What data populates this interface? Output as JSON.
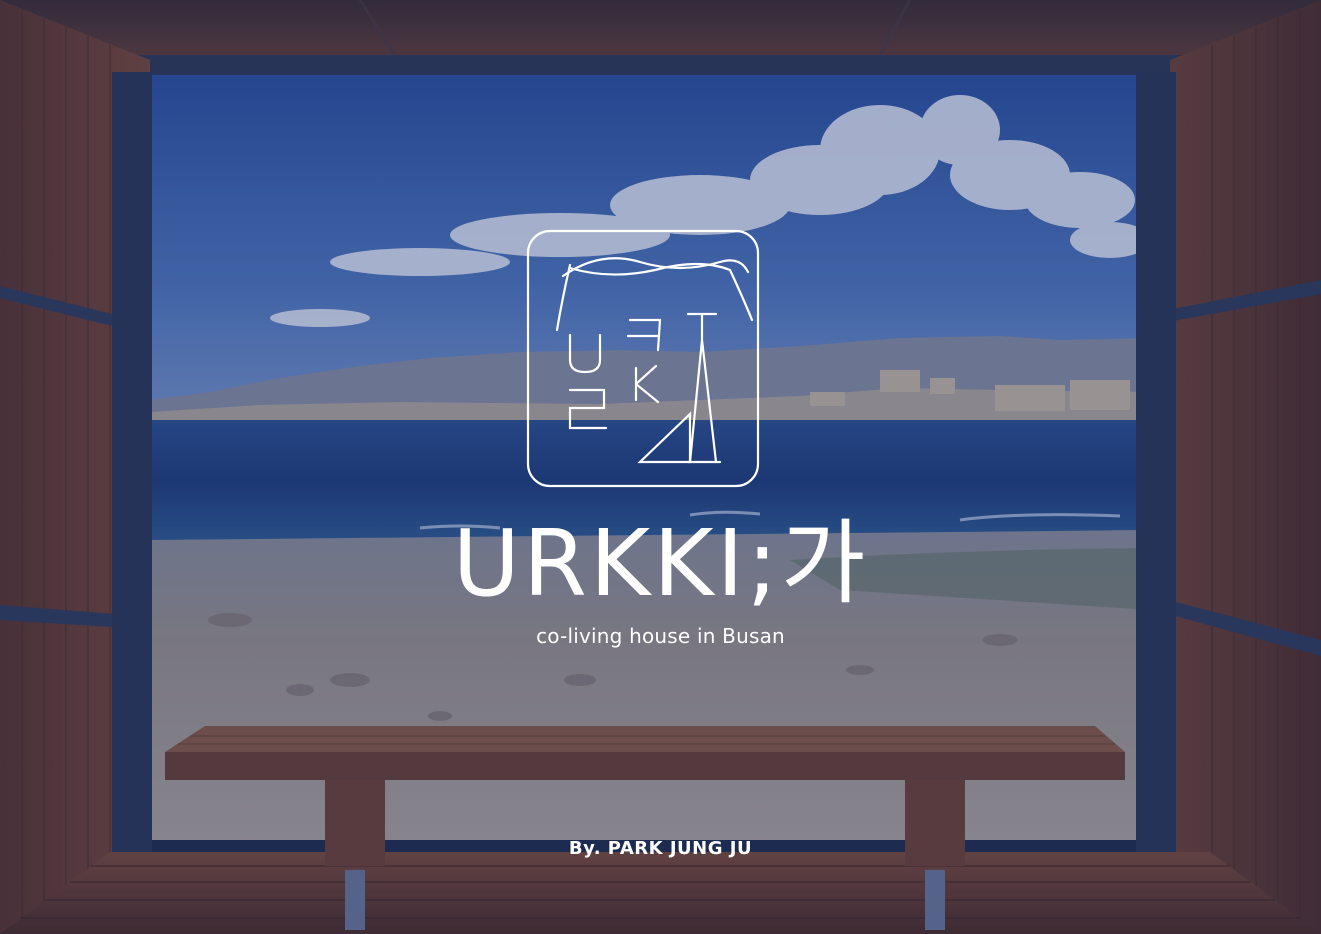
{
  "title": "URKKI;가",
  "subtitle": "co-living house in Busan",
  "byline": "By. PARK JUNG JU",
  "logo": {
    "name": "urkki-logo",
    "lettering": "U 2 ㅋ K ㅓ"
  },
  "colors": {
    "overlay": "#1c2f6a",
    "sky_top": "#2b58a6",
    "sky_low": "#5c83c4",
    "sea": "#1e3f7e",
    "wood": "#6a3d2c",
    "bench": "#7b4b35",
    "frame_steel": "#27354f",
    "text": "#ffffff"
  }
}
